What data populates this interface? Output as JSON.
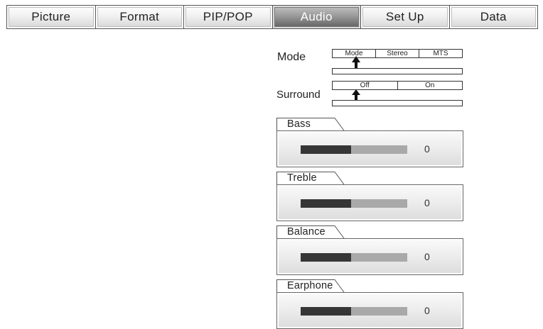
{
  "tabs": [
    {
      "label": "Picture",
      "active": false
    },
    {
      "label": "Format",
      "active": false
    },
    {
      "label": "PIP/POP",
      "active": false
    },
    {
      "label": "Audio",
      "active": true
    },
    {
      "label": "Set Up",
      "active": false
    },
    {
      "label": "Data",
      "active": false
    }
  ],
  "mode": {
    "label": "Mode",
    "options": [
      "Mode",
      "Stereo",
      "MTS"
    ]
  },
  "surround": {
    "label": "Surround",
    "options": [
      "Off",
      "On"
    ]
  },
  "sliders": [
    {
      "label": "Bass",
      "value": "0",
      "level": 0.47
    },
    {
      "label": "Treble",
      "value": "0",
      "level": 0.47
    },
    {
      "label": "Balance",
      "value": "0",
      "level": 0.47
    },
    {
      "label": "Earphone",
      "value": "0",
      "level": 0.47
    }
  ],
  "colors": {
    "active_tab": "#8a8a8a",
    "bar_fill": "#363636",
    "bar_track": "#a9a9a9"
  },
  "icons": [
    "up-arrow-pointer"
  ]
}
